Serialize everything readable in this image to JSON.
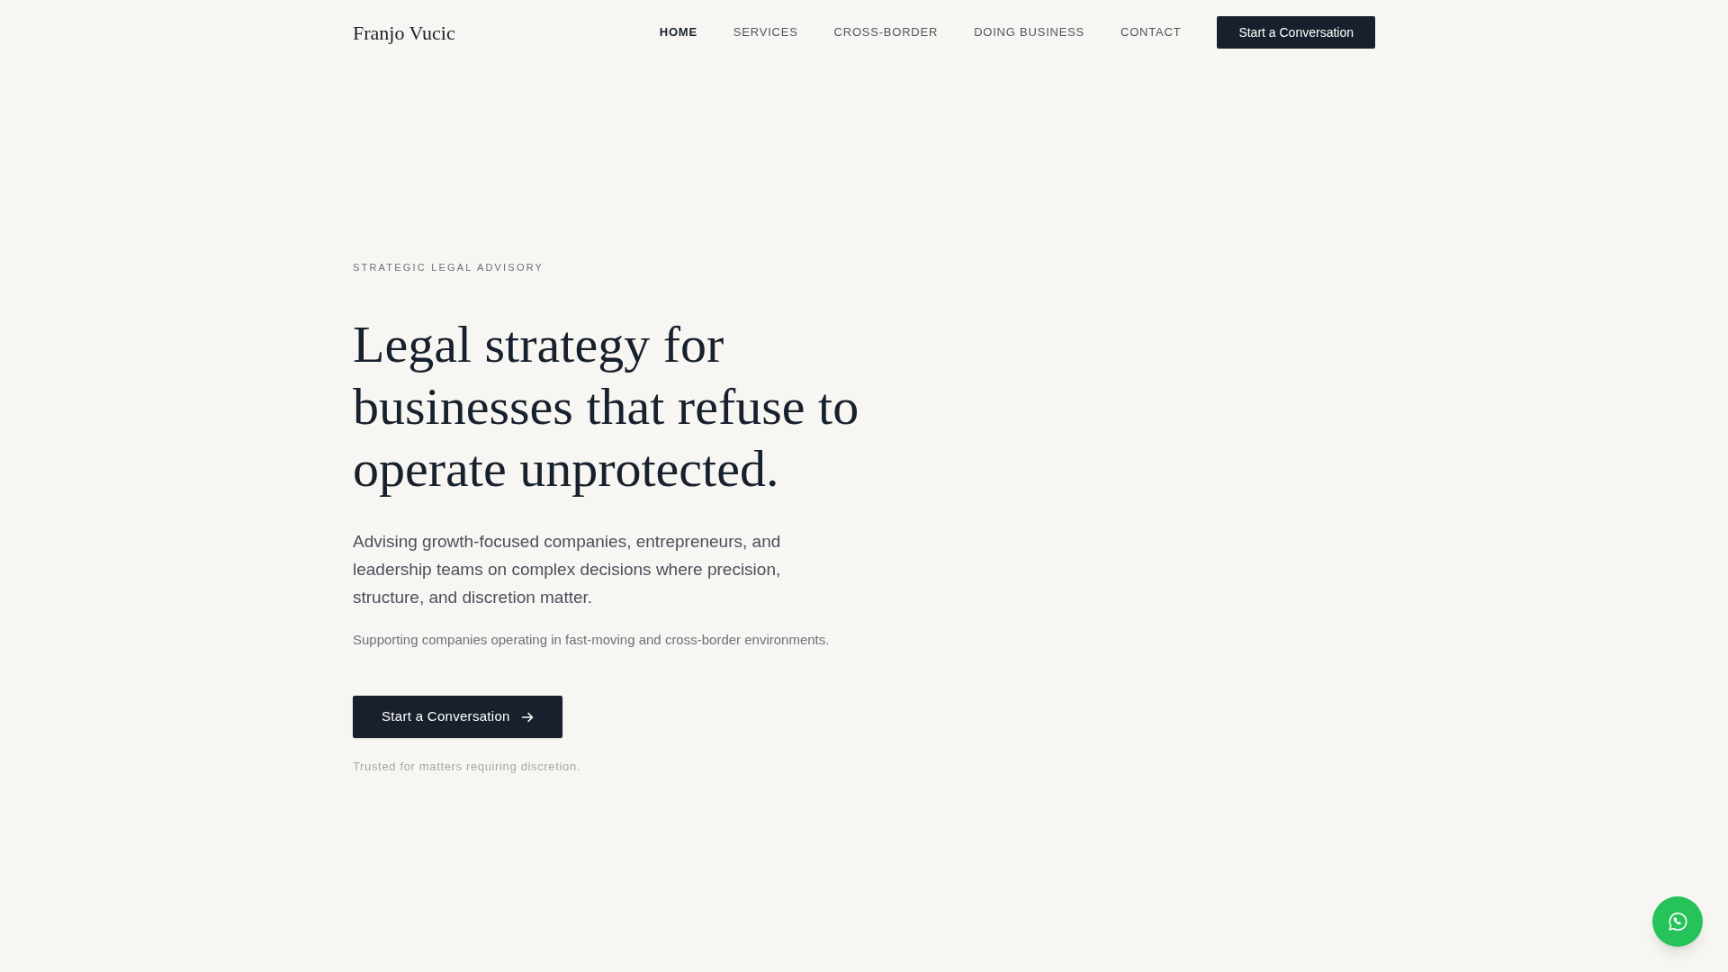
{
  "header": {
    "logo": "Franjo Vucic",
    "nav": [
      {
        "label": "HOME",
        "selected": true
      },
      {
        "label": "SERVICES",
        "selected": false
      },
      {
        "label": "CROSS-BORDER",
        "selected": false
      },
      {
        "label": "DOING BUSINESS",
        "selected": false
      },
      {
        "label": "CONTACT",
        "selected": false
      }
    ],
    "cta": "Start a Conversation"
  },
  "hero": {
    "eyebrow": "STRATEGIC LEGAL ADVISORY",
    "heading": "Legal strategy for businesses that refuse to operate unprotected.",
    "lead": "Advising growth-focused companies, entrepreneurs, and leadership teams on complex decisions where precision, structure, and discretion matter.",
    "note": "Supporting companies operating in fast-moving and cross-border environments.",
    "cta": "Start a Conversation",
    "trust_line": "Trusted for matters requiring discretion."
  }
}
